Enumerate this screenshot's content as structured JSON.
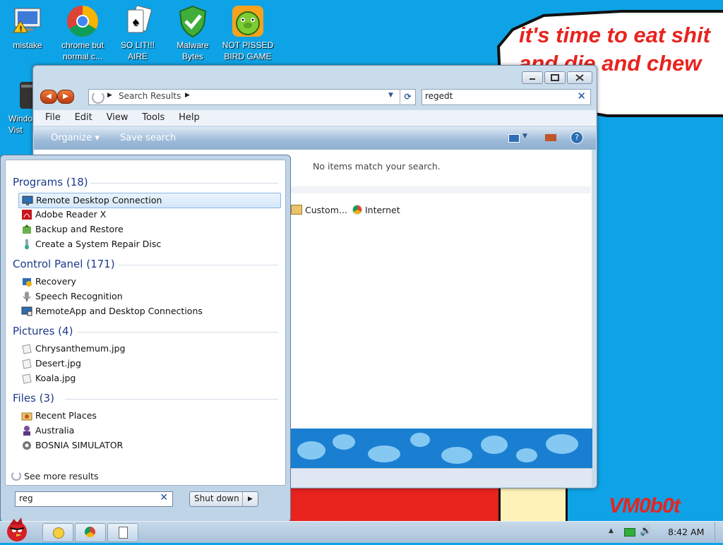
{
  "desktop": {
    "icons": [
      {
        "label": "mistake",
        "icon": "computer-warning-icon"
      },
      {
        "label": "chrome but normal c...",
        "icon": "chrome-icon"
      },
      {
        "label": "SO LIT!!! AIRE",
        "icon": "solitaire-cards-icon"
      },
      {
        "label": "Malware Bytes",
        "icon": "shield-check-icon"
      },
      {
        "label": "NOT PISSED BIRD GAME",
        "icon": "green-pig-icon"
      },
      {
        "label": "Windo Vist",
        "icon": "trash-bin-icon"
      }
    ],
    "bubble_text": "it's time to eat shit and die and chew gum",
    "signature": "VM0b0t"
  },
  "explorer": {
    "address_label": "Search Results",
    "search_value": "regedt",
    "menu": [
      "File",
      "Edit",
      "View",
      "Tools",
      "Help"
    ],
    "commands": {
      "organize": "Organize",
      "save_search": "Save search"
    },
    "empty_message": "No items match your search.",
    "search_again": [
      {
        "label": "Custom...",
        "icon": "folder-icon"
      },
      {
        "label": "Internet",
        "icon": "chrome-icon"
      }
    ]
  },
  "start_menu": {
    "groups": [
      {
        "title": "Programs (18)",
        "items": [
          {
            "label": "Remote Desktop Connection",
            "icon": "remote-desktop-icon",
            "selected": true
          },
          {
            "label": "Adobe Reader X",
            "icon": "adobe-reader-icon"
          },
          {
            "label": "Backup and Restore",
            "icon": "backup-icon"
          },
          {
            "label": "Create a System Repair Disc",
            "icon": "repair-disc-icon"
          }
        ]
      },
      {
        "title": "Control Panel (171)",
        "items": [
          {
            "label": "Recovery",
            "icon": "recovery-icon"
          },
          {
            "label": "Speech Recognition",
            "icon": "microphone-icon"
          },
          {
            "label": "RemoteApp and Desktop Connections",
            "icon": "remoteapp-icon"
          }
        ]
      },
      {
        "title": "Pictures (4)",
        "items": [
          {
            "label": "Chrysanthemum.jpg",
            "icon": "image-file-icon"
          },
          {
            "label": "Desert.jpg",
            "icon": "image-file-icon"
          },
          {
            "label": "Koala.jpg",
            "icon": "image-file-icon"
          }
        ]
      },
      {
        "title": "Files (3)",
        "items": [
          {
            "label": "Recent Places",
            "icon": "recent-places-icon"
          },
          {
            "label": "Australia",
            "icon": "australia-icon"
          },
          {
            "label": "BOSNIA SIMULATOR",
            "icon": "gear-icon"
          }
        ]
      }
    ],
    "see_more": "See more results",
    "search_value": "reg",
    "shutdown_label": "Shut down"
  },
  "taskbar": {
    "time": "8:42 AM",
    "apps": [
      "explorer-icon",
      "chrome-icon",
      "solitaire-cards-icon"
    ]
  }
}
